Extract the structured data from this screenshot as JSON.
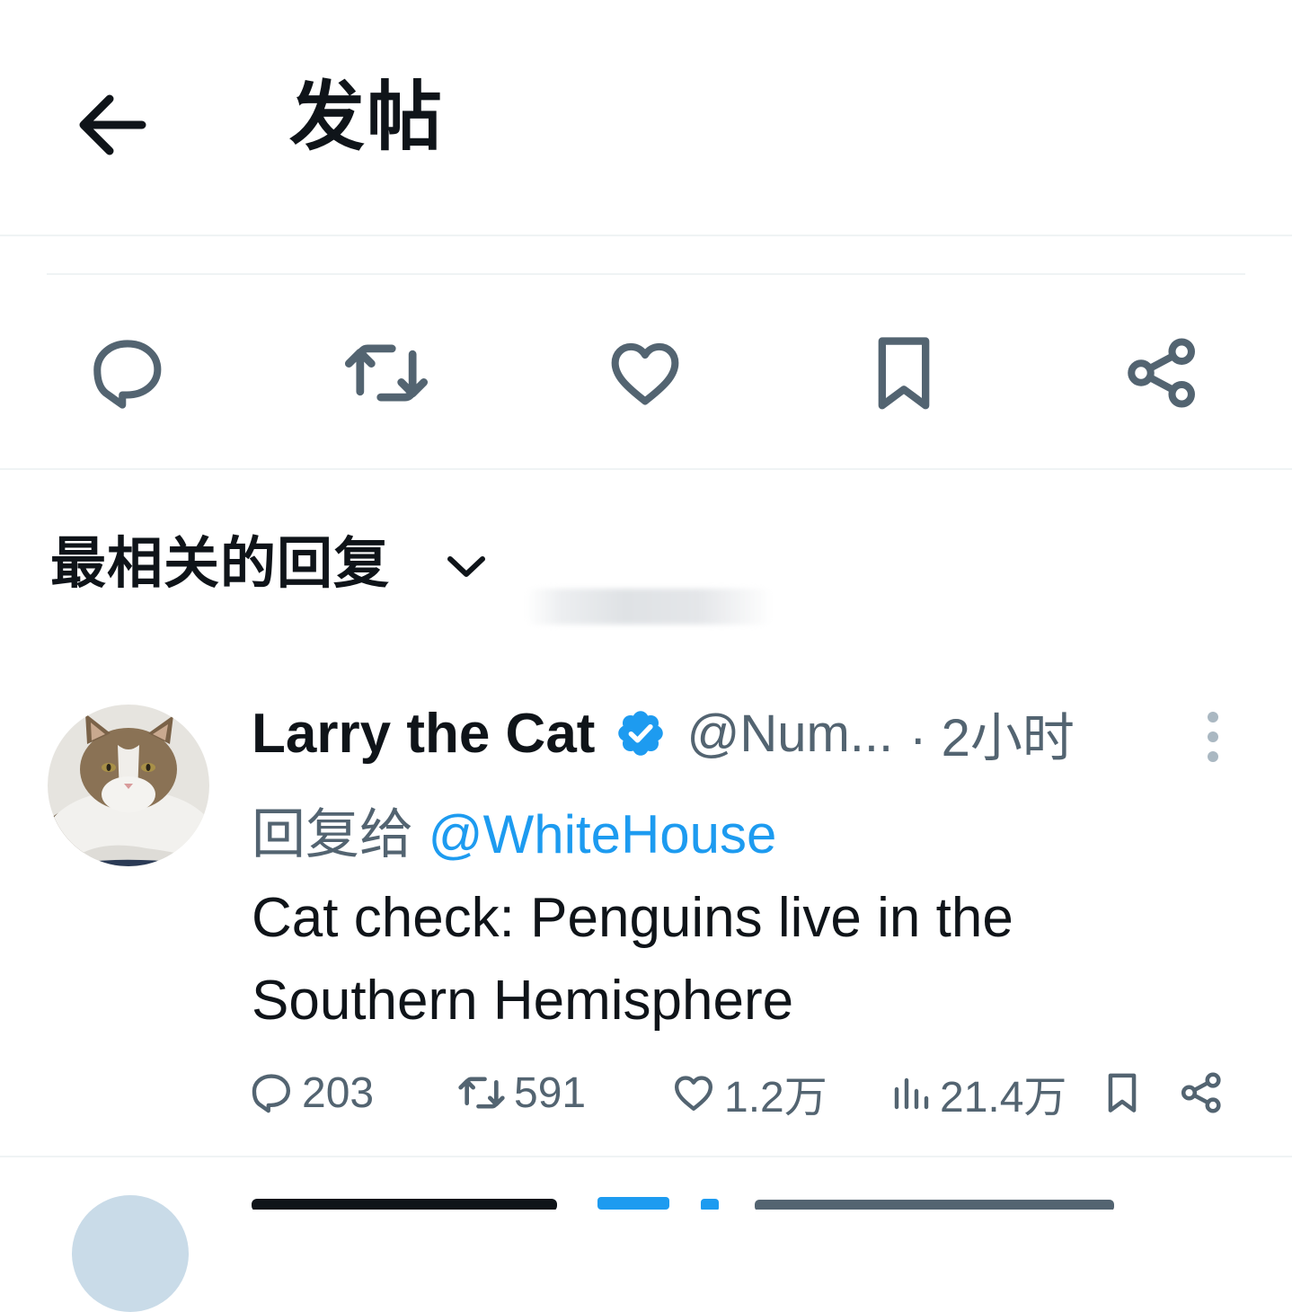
{
  "header": {
    "title": "发帖",
    "back_icon": "arrow-left-icon"
  },
  "action_bar": {
    "icons": [
      "reply-icon",
      "retweet-icon",
      "like-icon",
      "bookmark-icon",
      "share-icon"
    ]
  },
  "sort": {
    "label": "最相关的回复",
    "icon": "chevron-down-icon"
  },
  "reply": {
    "author": {
      "name": "Larry the Cat",
      "handle": "@Num...",
      "verified": true,
      "verified_color": "#1d9bf0"
    },
    "time": "· 2小时",
    "reply_to_prefix": "回复给 ",
    "reply_to_handle": "@WhiteHouse",
    "text": "Cat check: Penguins live in the Southern Hemisphere",
    "stats": {
      "replies": "203",
      "retweets": "591",
      "likes": "1.2万",
      "views": "21.4万"
    }
  },
  "colors": {
    "text_primary": "#0f1419",
    "text_secondary": "#536471",
    "link": "#1d9bf0",
    "divider": "#eff3f4"
  }
}
